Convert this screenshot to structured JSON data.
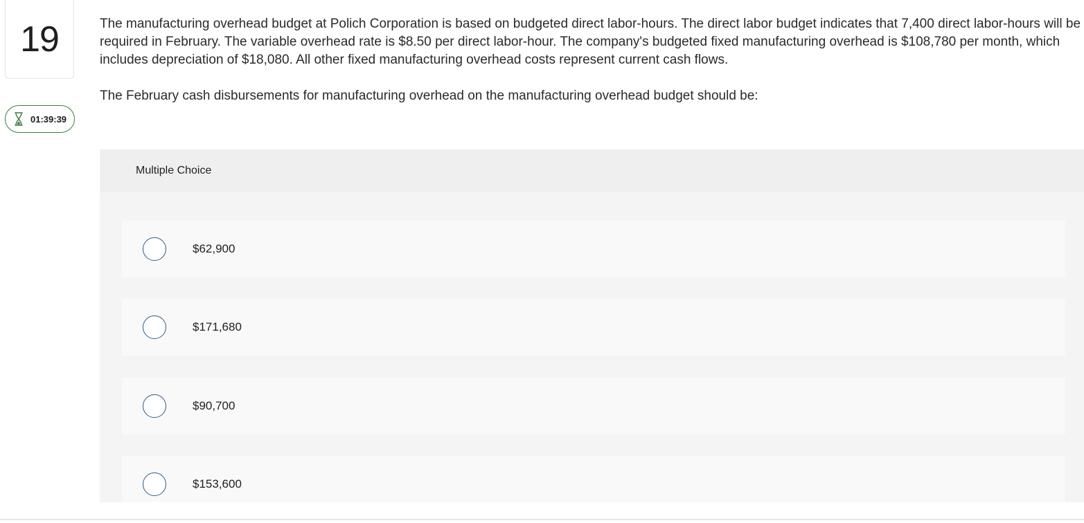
{
  "question": {
    "number": "19",
    "timer": "01:39:39",
    "text": "The manufacturing overhead budget at Polich Corporation is based on budgeted direct labor-hours. The direct labor budget indicates that 7,400 direct labor-hours will be required in February. The variable overhead rate is $8.50 per direct labor-hour. The company's budgeted fixed manufacturing overhead is $108,780 per month, which includes depreciation of $18,080. All other fixed manufacturing overhead costs represent current cash flows.",
    "prompt": "The February cash disbursements for manufacturing overhead on the manufacturing overhead budget should be:"
  },
  "multiple_choice": {
    "header": "Multiple Choice",
    "options": [
      {
        "label": "$62,900"
      },
      {
        "label": "$171,680"
      },
      {
        "label": "$90,700"
      },
      {
        "label": "$153,600"
      }
    ]
  },
  "icons": {
    "timer": "hourglass-icon",
    "radio": "radio-button-icon"
  },
  "colors": {
    "timer_border": "#3b7a3e",
    "radio_border": "#2b5a86",
    "panel_background": "#f4f4f4"
  }
}
